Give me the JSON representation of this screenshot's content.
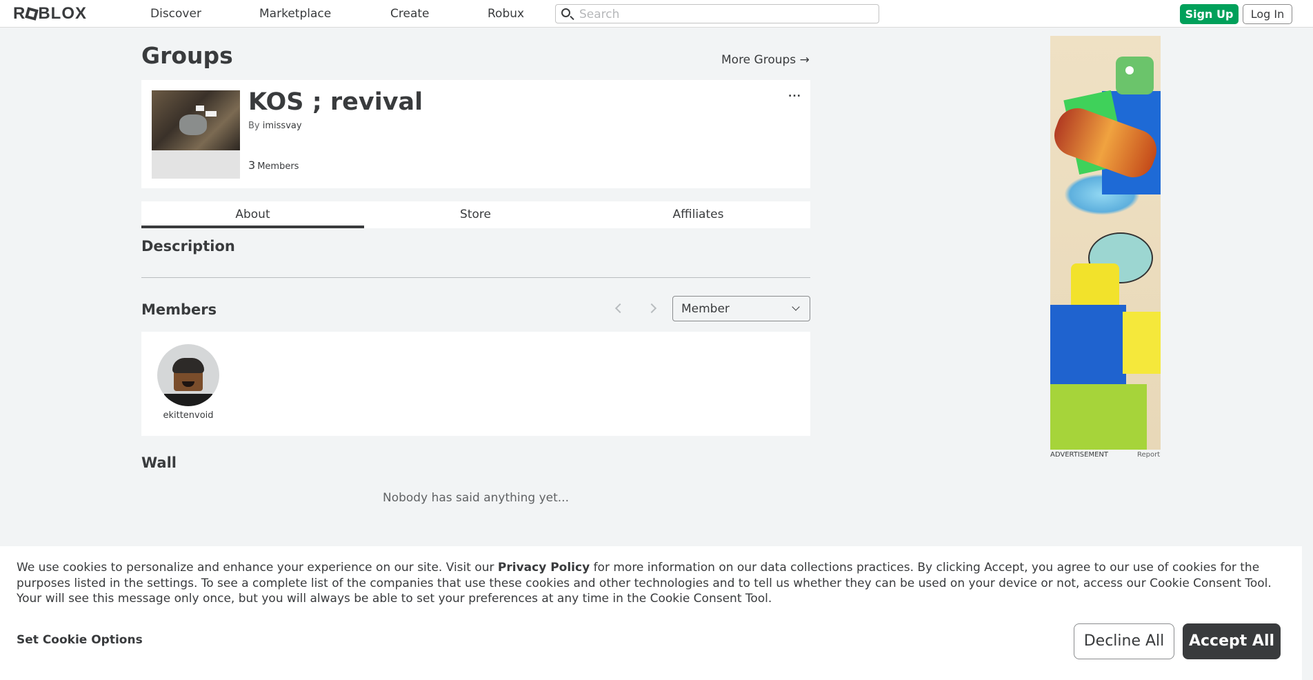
{
  "nav": {
    "logo": "ROBLOX",
    "links": [
      "Discover",
      "Marketplace",
      "Create",
      "Robux"
    ],
    "search_placeholder": "Search",
    "signup": "Sign Up",
    "login": "Log In"
  },
  "page": {
    "title": "Groups",
    "more_groups": "More Groups →"
  },
  "group": {
    "name": "KOS ; revival",
    "by_prefix": "By",
    "owner": "imissvay",
    "member_count": "3",
    "member_label": "Members",
    "menu": "..."
  },
  "tabs": [
    "About",
    "Store",
    "Affiliates"
  ],
  "sections": {
    "description": "Description",
    "members": "Members",
    "wall": "Wall",
    "wall_empty": "Nobody has said anything yet..."
  },
  "members": {
    "role_selected": "Member",
    "list": [
      {
        "name": "ekittenvoid"
      }
    ]
  },
  "ad": {
    "label": "ADVERTISEMENT",
    "report": "Report"
  },
  "cookie": {
    "text_before": "We use cookies to personalize and enhance your experience on our site. Visit our ",
    "privacy_link": "Privacy Policy",
    "text_after": " for more information on our data collections practices. By clicking Accept, you agree to our use of cookies for the purposes listed in the settings. To see a complete list of the companies that use these cookies and other technologies and to tell us whether they can be used on your device or not, access our Cookie Consent Tool. Your will see this message only once, but you will always be able to set your preferences at any time in the Cookie Consent Tool.",
    "options": "Set Cookie Options",
    "decline": "Decline All",
    "accept": "Accept All"
  },
  "colors": {
    "signup_green": "#00a05a",
    "accept_dark": "#393b3d",
    "page_bg": "#f2f4f5"
  }
}
